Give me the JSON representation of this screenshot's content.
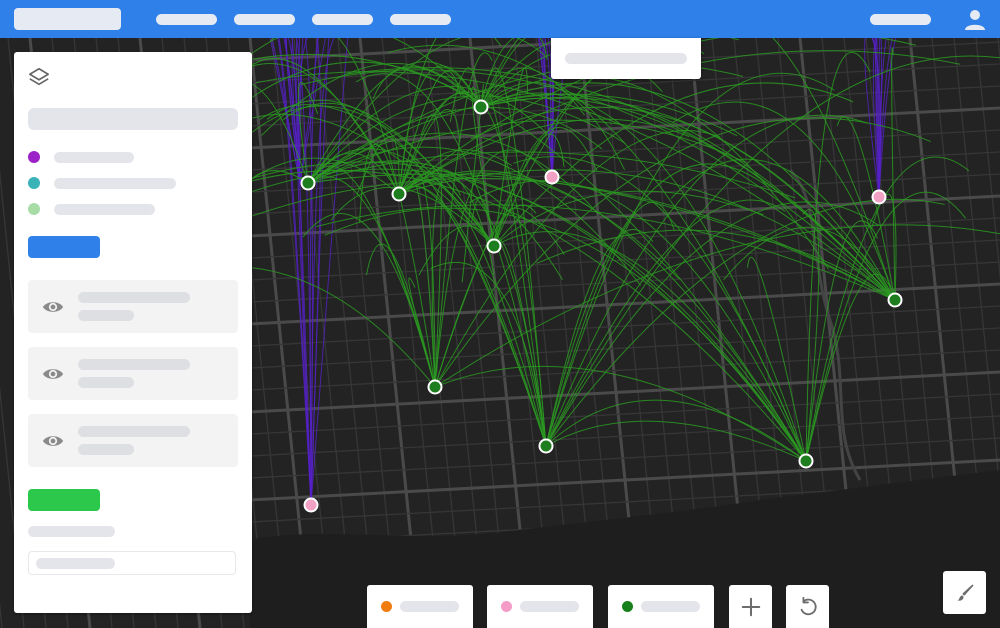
{
  "header": {
    "user_icon": "user-icon"
  },
  "panel": {
    "layers_icon": "layers-icon",
    "legend_colors": [
      "#9b22c7",
      "#3ab3b8",
      "#a8dca7"
    ],
    "layer_cards": [
      {
        "icon": "eye-icon"
      },
      {
        "icon": "eye-icon"
      },
      {
        "icon": "eye-icon"
      }
    ],
    "primary_color": "#2f80e8",
    "success_color": "#2cc84c"
  },
  "bottom_bar": {
    "legend": [
      {
        "color": "#f07c12"
      },
      {
        "color": "#f59bc8"
      },
      {
        "color": "#18801a"
      }
    ],
    "add_icon": "plus-icon",
    "reset_icon": "rotate-ccw-icon",
    "style_icon": "paintbrush-icon"
  },
  "map": {
    "background": "#232323",
    "flow_colors": {
      "green": "#2a9a21",
      "purple": "#5520c7"
    },
    "node_categories": [
      "green",
      "pink"
    ],
    "nodes": [
      {
        "category": "green"
      },
      {
        "category": "green"
      },
      {
        "category": "green"
      },
      {
        "category": "green"
      },
      {
        "category": "green"
      },
      {
        "category": "green"
      },
      {
        "category": "green"
      },
      {
        "category": "green"
      },
      {
        "category": "pink"
      },
      {
        "category": "pink"
      },
      {
        "category": "pink"
      }
    ]
  }
}
